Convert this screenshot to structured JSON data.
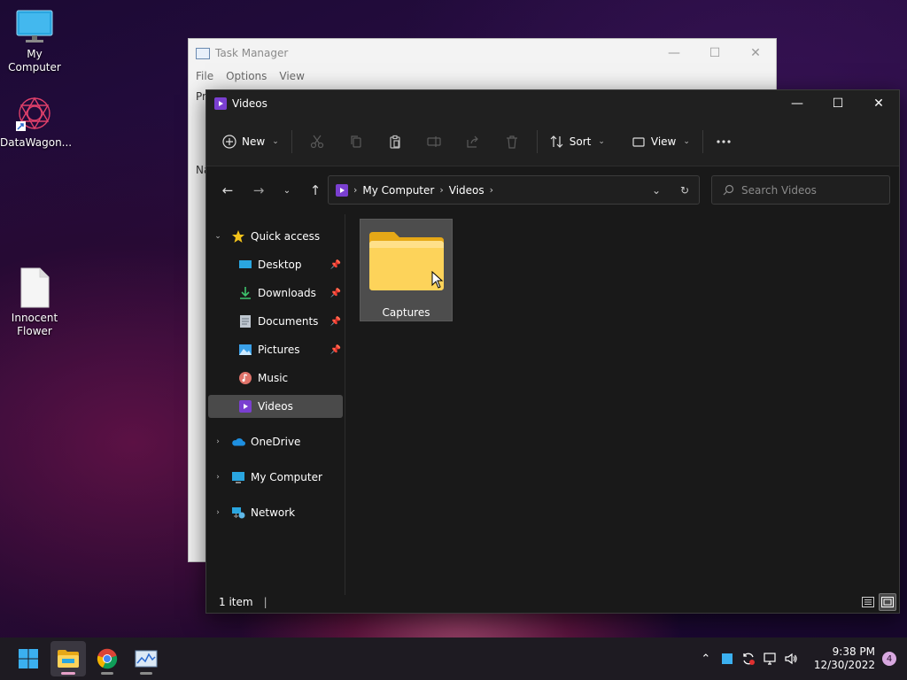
{
  "desktop": {
    "icons": [
      {
        "label": "My Computer"
      },
      {
        "label": "DataWagon..."
      },
      {
        "label": "Innocent Flower"
      }
    ]
  },
  "task_manager": {
    "title": "Task Manager",
    "menu": [
      "File",
      "Options",
      "View"
    ],
    "peek_1": "Pr",
    "peek_2": "Na"
  },
  "explorer": {
    "title": "Videos",
    "toolbar": {
      "new_label": "New",
      "sort_label": "Sort",
      "view_label": "View"
    },
    "address": {
      "crumbs": [
        "My Computer",
        "Videos"
      ]
    },
    "search": {
      "placeholder": "Search Videos"
    },
    "sidebar": {
      "quick_access": "Quick access",
      "items": [
        {
          "label": "Desktop"
        },
        {
          "label": "Downloads"
        },
        {
          "label": "Documents"
        },
        {
          "label": "Pictures"
        },
        {
          "label": "Music"
        },
        {
          "label": "Videos"
        }
      ],
      "onedrive": "OneDrive",
      "my_computer": "My Computer",
      "network": "Network"
    },
    "content": {
      "folders": [
        {
          "name": "Captures"
        }
      ]
    },
    "status": {
      "count": "1 item"
    }
  },
  "taskbar": {
    "time": "9:38 PM",
    "date": "12/30/2022",
    "notifications": "4"
  }
}
